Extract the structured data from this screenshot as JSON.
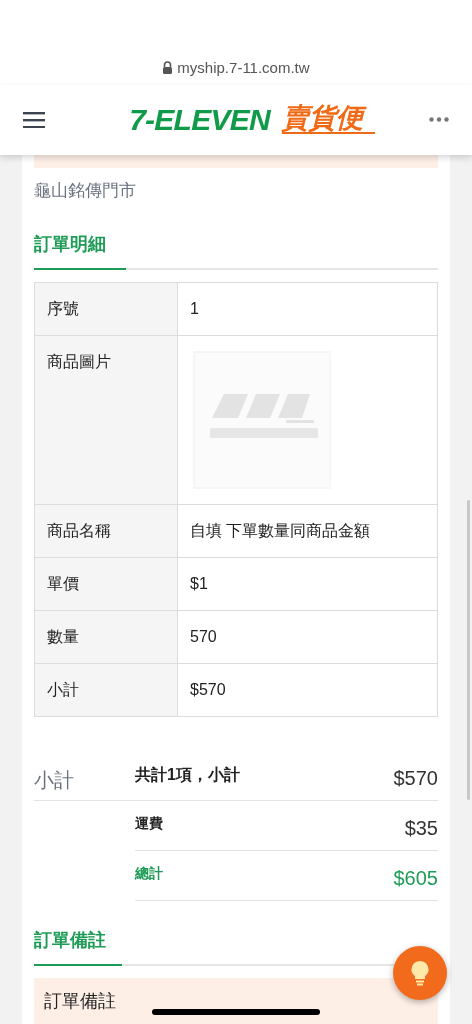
{
  "browser": {
    "url": "myship.7-11.com.tw"
  },
  "header": {
    "brand": "7-ELEVEN",
    "service": "賣貨便"
  },
  "store": "龜山銘傳門市",
  "order_details": {
    "title": "訂單明細",
    "rows": [
      {
        "kind": "text",
        "label": "序號",
        "value": "1"
      },
      {
        "kind": "picture",
        "label": "商品圖片"
      },
      {
        "kind": "text",
        "label": "商品名稱",
        "value": "自填 下單數量同商品金額"
      },
      {
        "kind": "text",
        "label": "單價",
        "value": "$1"
      },
      {
        "kind": "text",
        "label": "數量",
        "value": "570"
      },
      {
        "kind": "text",
        "label": "小計",
        "value": "$570"
      }
    ]
  },
  "summary": {
    "title": "小計",
    "lines": [
      {
        "kind": "subtotal",
        "label": "共計1項，小計",
        "amount": "$570"
      },
      {
        "kind": "fee",
        "label": "運費",
        "amount": "$35"
      },
      {
        "kind": "total",
        "label": "總計",
        "amount": "$605"
      }
    ]
  },
  "order_note": {
    "title": "訂單備註",
    "box_label": "訂單備註"
  }
}
